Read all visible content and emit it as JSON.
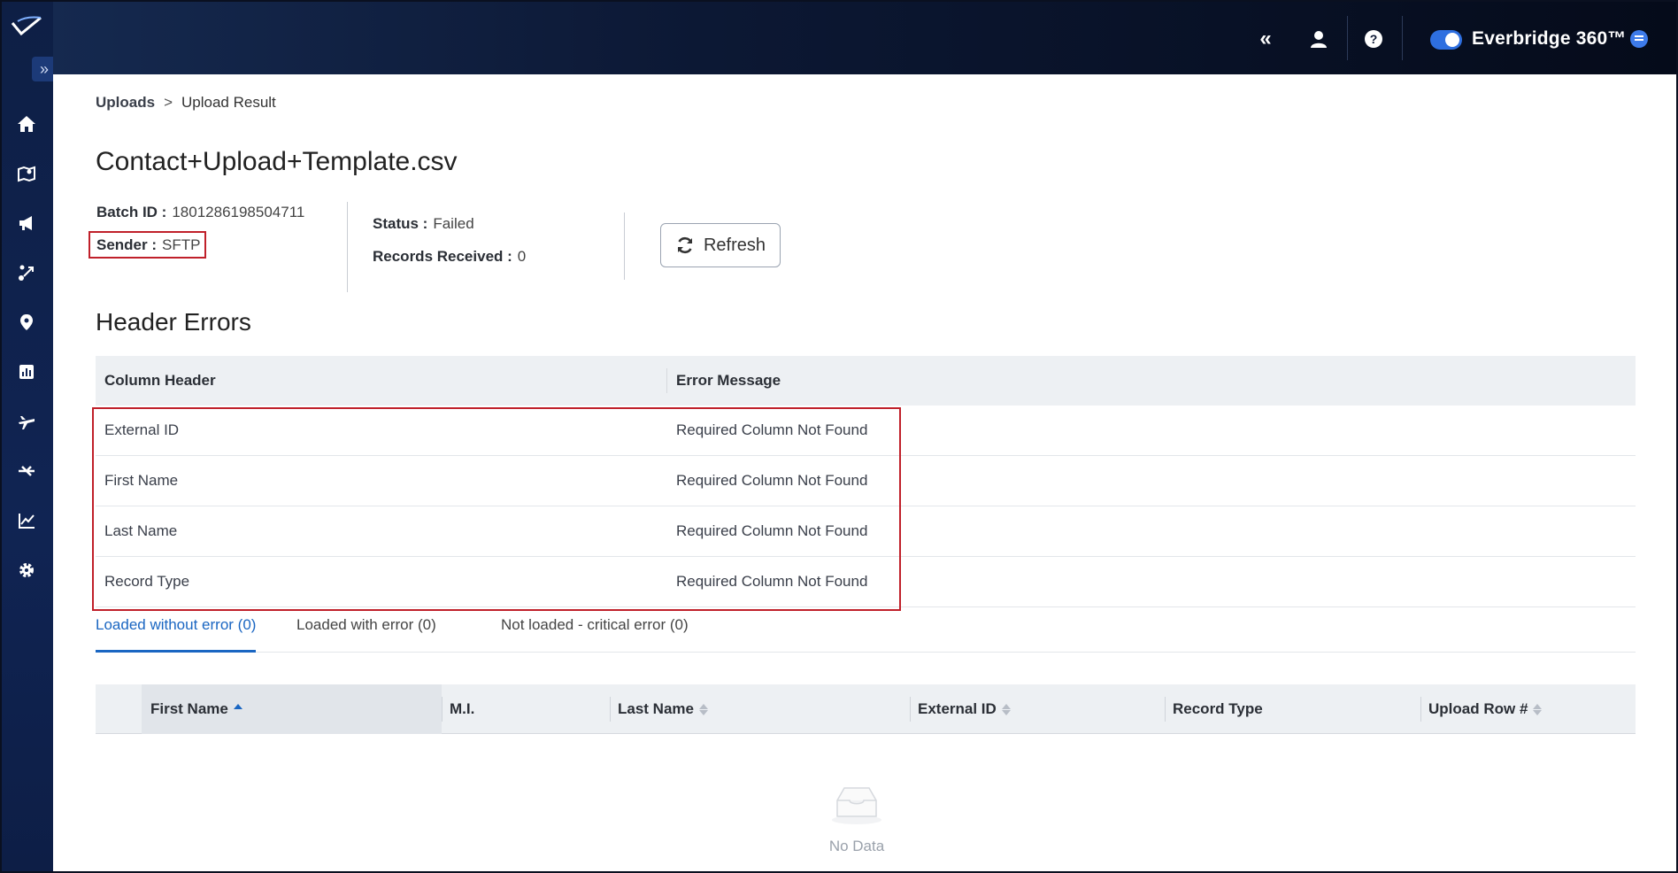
{
  "topbar": {
    "brand": "Everbridge 360™",
    "icons": [
      "collapse-icon",
      "user-icon",
      "help-icon",
      "toggle-switch",
      "chat-icon"
    ]
  },
  "sidebar": {
    "items": [
      "home-icon",
      "map-icon",
      "megaphone-icon",
      "workflow-icon",
      "location-icon",
      "report-icon",
      "travel-icon",
      "integration-icon",
      "analytics-icon",
      "settings-icon"
    ]
  },
  "breadcrumb": {
    "parent": "Uploads",
    "separator": ">",
    "current": "Upload Result"
  },
  "page": {
    "title": "Contact+Upload+Template.csv"
  },
  "meta": {
    "batch_label": "Batch ID :",
    "batch_value": "1801286198504711",
    "sender_label": "Sender :",
    "sender_value": "SFTP",
    "status_label": "Status :",
    "status_value": "Failed",
    "records_label": "Records Received :",
    "records_value": "0"
  },
  "refresh": {
    "label": "Refresh"
  },
  "header_errors": {
    "title": "Header Errors",
    "columns": [
      "Column Header",
      "Error Message"
    ],
    "rows": [
      [
        "External ID",
        "Required Column Not Found"
      ],
      [
        "First Name",
        "Required Column Not Found"
      ],
      [
        "Last Name",
        "Required Column Not Found"
      ],
      [
        "Record Type",
        "Required Column Not Found"
      ]
    ]
  },
  "tabs": [
    {
      "label": "Loaded without error (0)",
      "active": true
    },
    {
      "label": "Loaded with error (0)",
      "active": false
    },
    {
      "label": "Not loaded - critical error (0)",
      "active": false
    }
  ],
  "data_table": {
    "columns": [
      "First Name",
      "M.I.",
      "Last Name",
      "External ID",
      "Record Type",
      "Upload Row #"
    ],
    "empty_text": "No Data"
  },
  "colors": {
    "accent": "#1a66c2",
    "highlight": "#c0202a",
    "topbar": "#0c1834"
  }
}
